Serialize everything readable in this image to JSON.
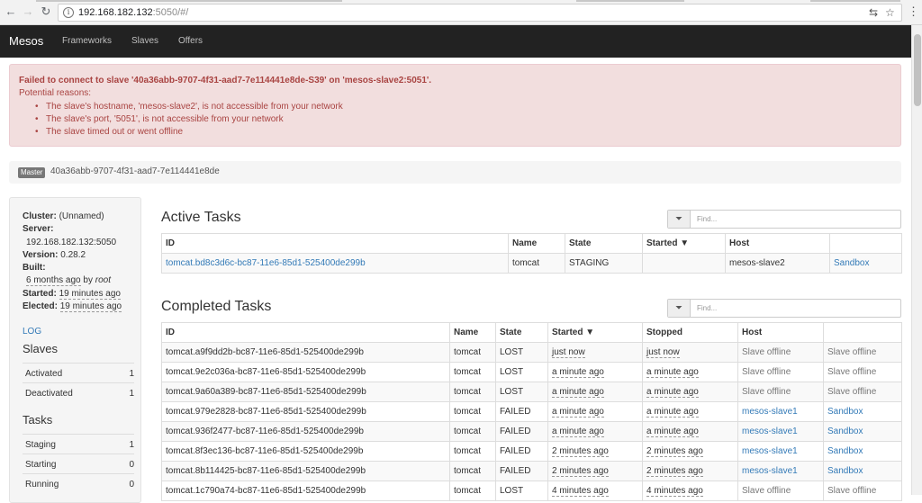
{
  "browser": {
    "url_host": "192.168.182.132",
    "url_rest": ":5050/#/"
  },
  "navbar": {
    "brand": "Mesos",
    "items": [
      "Frameworks",
      "Slaves",
      "Offers"
    ]
  },
  "alert": {
    "title": "Failed to connect to slave '40a36abb-9707-4f31-aad7-7e114441e8de-S39' on 'mesos-slave2:5051'.",
    "subtitle": "Potential reasons:",
    "reasons": [
      "The slave's hostname, 'mesos-slave2', is not accessible from your network",
      "The slave's port, '5051', is not accessible from your network",
      "The slave timed out or went offline"
    ]
  },
  "master": {
    "badge": "Master",
    "id": "40a36abb-9707-4f31-aad7-7e114441e8de"
  },
  "sidebar": {
    "cluster_label": "Cluster:",
    "cluster_value": "(Unnamed)",
    "server_label": "Server:",
    "server_value": "192.168.182.132:5050",
    "version_label": "Version:",
    "version_value": "0.28.2",
    "built_label": "Built:",
    "built_ago": "6 months ago",
    "built_by": "by",
    "built_user": "root",
    "started_label": "Started:",
    "started_value": "19 minutes ago",
    "elected_label": "Elected:",
    "elected_value": "19 minutes ago",
    "log_link": "LOG",
    "slaves_heading": "Slaves",
    "slaves": [
      {
        "label": "Activated",
        "value": "1"
      },
      {
        "label": "Deactivated",
        "value": "1"
      }
    ],
    "tasks_heading": "Tasks",
    "tasks": [
      {
        "label": "Staging",
        "value": "1"
      },
      {
        "label": "Starting",
        "value": "0"
      },
      {
        "label": "Running",
        "value": "0"
      }
    ]
  },
  "active_tasks": {
    "title": "Active Tasks",
    "find_placeholder": "Find...",
    "columns": [
      "ID",
      "Name",
      "State",
      "Started ▼",
      "Host",
      ""
    ],
    "rows": [
      {
        "id": "tomcat.bd8c3d6c-bc87-11e6-85d1-525400de299b",
        "name": "tomcat",
        "state": "STAGING",
        "started": "",
        "host": "mesos-slave2",
        "sandbox": "Sandbox"
      }
    ]
  },
  "completed_tasks": {
    "title": "Completed Tasks",
    "find_placeholder": "Find...",
    "columns": [
      "ID",
      "Name",
      "State",
      "Started ▼",
      "Stopped",
      "Host",
      ""
    ],
    "rows": [
      {
        "id": "tomcat.a9f9dd2b-bc87-11e6-85d1-525400de299b",
        "name": "tomcat",
        "state": "LOST",
        "started": "just now",
        "stopped": "just now",
        "host": "Slave offline",
        "sandbox": "Slave offline"
      },
      {
        "id": "tomcat.9e2c036a-bc87-11e6-85d1-525400de299b",
        "name": "tomcat",
        "state": "LOST",
        "started": "a minute ago",
        "stopped": "a minute ago",
        "host": "Slave offline",
        "sandbox": "Slave offline"
      },
      {
        "id": "tomcat.9a60a389-bc87-11e6-85d1-525400de299b",
        "name": "tomcat",
        "state": "LOST",
        "started": "a minute ago",
        "stopped": "a minute ago",
        "host": "Slave offline",
        "sandbox": "Slave offline"
      },
      {
        "id": "tomcat.979e2828-bc87-11e6-85d1-525400de299b",
        "name": "tomcat",
        "state": "FAILED",
        "started": "a minute ago",
        "stopped": "a minute ago",
        "host": "mesos-slave1",
        "sandbox": "Sandbox"
      },
      {
        "id": "tomcat.936f2477-bc87-11e6-85d1-525400de299b",
        "name": "tomcat",
        "state": "FAILED",
        "started": "a minute ago",
        "stopped": "a minute ago",
        "host": "mesos-slave1",
        "sandbox": "Sandbox"
      },
      {
        "id": "tomcat.8f3ec136-bc87-11e6-85d1-525400de299b",
        "name": "tomcat",
        "state": "FAILED",
        "started": "2 minutes ago",
        "stopped": "2 minutes ago",
        "host": "mesos-slave1",
        "sandbox": "Sandbox"
      },
      {
        "id": "tomcat.8b114425-bc87-11e6-85d1-525400de299b",
        "name": "tomcat",
        "state": "FAILED",
        "started": "2 minutes ago",
        "stopped": "2 minutes ago",
        "host": "mesos-slave1",
        "sandbox": "Sandbox"
      },
      {
        "id": "tomcat.1c790a74-bc87-11e6-85d1-525400de299b",
        "name": "tomcat",
        "state": "LOST",
        "started": "4 minutes ago",
        "stopped": "4 minutes ago",
        "host": "Slave offline",
        "sandbox": "Slave offline"
      }
    ]
  }
}
